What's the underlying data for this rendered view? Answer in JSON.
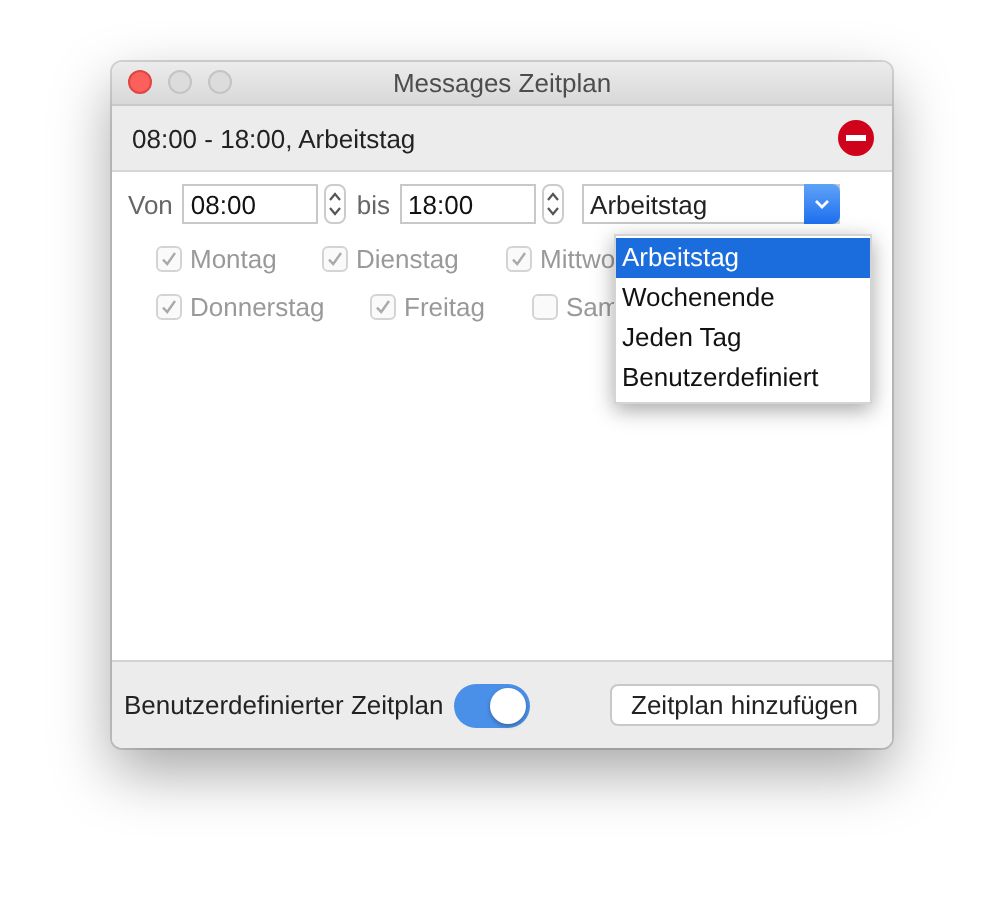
{
  "window": {
    "title": "Messages Zeitplan"
  },
  "schedule_header": {
    "label": "08:00 - 18:00, Arbeitstag"
  },
  "time_row": {
    "from_label": "Von",
    "from_value": "08:00",
    "to_label": "bis",
    "to_value": "18:00",
    "preset": "Arbeitstag"
  },
  "days": [
    [
      {
        "label": "Montag",
        "checked": true,
        "disabled": true
      },
      {
        "label": "Dienstag",
        "checked": true,
        "disabled": true
      },
      {
        "label": "Mittwo",
        "checked": true,
        "disabled": true
      }
    ],
    [
      {
        "label": "Donnerstag",
        "checked": true,
        "disabled": true
      },
      {
        "label": "Freitag",
        "checked": true,
        "disabled": true
      },
      {
        "label": "Sam",
        "checked": false,
        "disabled": true
      }
    ]
  ],
  "preset_menu": [
    {
      "label": "Arbeitstag",
      "selected": true
    },
    {
      "label": "Wochenende",
      "selected": false
    },
    {
      "label": "Jeden Tag",
      "selected": false
    },
    {
      "label": "Benutzerdefiniert",
      "selected": false
    }
  ],
  "footer": {
    "toggle_label": "Benutzerdefinierter Zeitplan",
    "toggle_on": true,
    "button": "Zeitplan hinzufügen"
  }
}
